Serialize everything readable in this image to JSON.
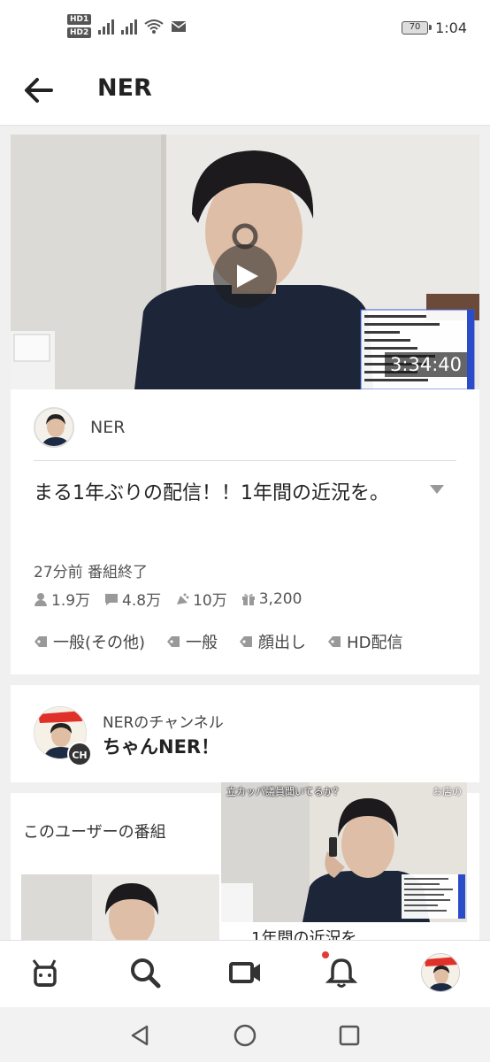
{
  "status_bar": {
    "hd1": "HD1",
    "hd2": "HD2",
    "battery": "70",
    "time": "1:04"
  },
  "header": {
    "title": "NER"
  },
  "program": {
    "duration": "3:34:40",
    "channel_name": "NER",
    "title": "まる1年ぶりの配信！！1年間の近況を。",
    "time_status": "27分前 番組終了",
    "stats": {
      "viewers": "1.9万",
      "comments": "4.8万",
      "ads": "10万",
      "gifts": "3,200"
    },
    "tags": [
      "一般(その他)",
      "一般",
      "顔出し",
      "HD配信"
    ]
  },
  "channel": {
    "subtitle": "NERのチャンネル",
    "name": "ちゃんNER！",
    "badge": "CH"
  },
  "user_programs": {
    "title": "このユーザーの番組",
    "partial_title": "1年間の近況を"
  },
  "pip": {
    "caption_left": "立カッパ議員聞いてるか？",
    "caption_right": "お店の"
  },
  "nav": {
    "notification_dot": true
  },
  "colors": {
    "background": "#f0f0f0",
    "card": "#ffffff",
    "accent_dot": "#e53935"
  }
}
